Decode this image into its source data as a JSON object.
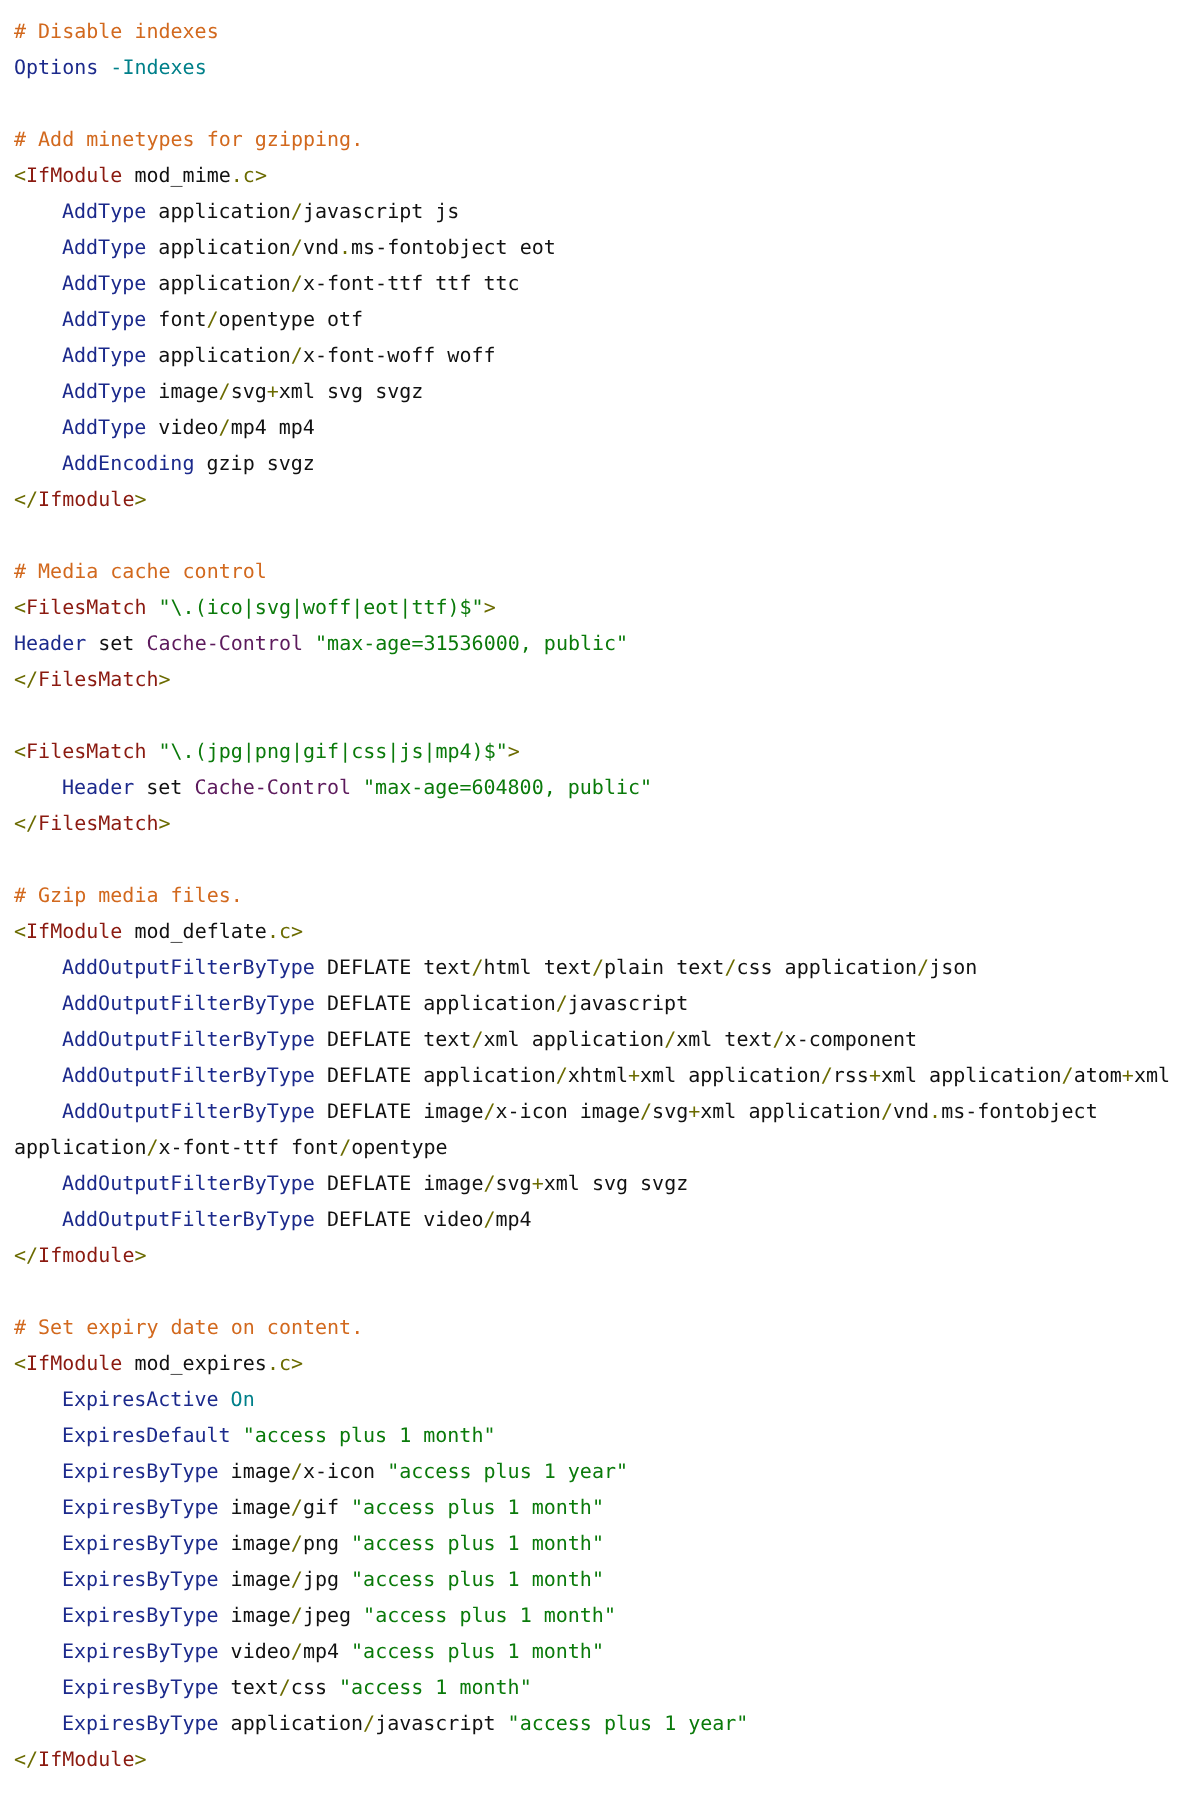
{
  "sections": [
    {
      "lines": [
        {
          "tokens": [
            {
              "kind": "comment",
              "text": "# Disable indexes"
            }
          ]
        },
        {
          "tokens": [
            {
              "kind": "keyword",
              "text": "Options"
            },
            {
              "kind": "constant",
              "text": " -Indexes"
            }
          ]
        }
      ]
    },
    {
      "lines": [
        {
          "tokens": [
            {
              "kind": "comment",
              "text": "# Add minetypes for gzipping."
            }
          ]
        },
        {
          "tokens": [
            {
              "kind": "punct",
              "text": "<"
            },
            {
              "kind": "tag",
              "text": "IfModule"
            },
            {
              "kind": "plain",
              "text": " mod_mime"
            },
            {
              "kind": "punct",
              "text": ".c"
            },
            {
              "kind": "punct",
              "text": ">"
            }
          ],
          "children": [
            {
              "tokens": [
                {
                  "kind": "keyword",
                  "text": "AddType"
                },
                {
                  "kind": "plain",
                  "text": " application"
                },
                {
                  "kind": "punct",
                  "text": "/"
                },
                {
                  "kind": "plain",
                  "text": "javascript js"
                }
              ]
            },
            {
              "tokens": [
                {
                  "kind": "keyword",
                  "text": "AddType"
                },
                {
                  "kind": "plain",
                  "text": " application"
                },
                {
                  "kind": "punct",
                  "text": "/"
                },
                {
                  "kind": "plain",
                  "text": "vnd"
                },
                {
                  "kind": "punct",
                  "text": "."
                },
                {
                  "kind": "plain",
                  "text": "ms-fontobject eot"
                }
              ]
            },
            {
              "tokens": [
                {
                  "kind": "keyword",
                  "text": "AddType"
                },
                {
                  "kind": "plain",
                  "text": " application"
                },
                {
                  "kind": "punct",
                  "text": "/"
                },
                {
                  "kind": "plain",
                  "text": "x-font-ttf ttf ttc"
                }
              ]
            },
            {
              "tokens": [
                {
                  "kind": "keyword",
                  "text": "AddType"
                },
                {
                  "kind": "plain",
                  "text": " font"
                },
                {
                  "kind": "punct",
                  "text": "/"
                },
                {
                  "kind": "plain",
                  "text": "opentype otf"
                }
              ]
            },
            {
              "tokens": [
                {
                  "kind": "keyword",
                  "text": "AddType"
                },
                {
                  "kind": "plain",
                  "text": " application"
                },
                {
                  "kind": "punct",
                  "text": "/"
                },
                {
                  "kind": "plain",
                  "text": "x-font-woff woff"
                }
              ]
            },
            {
              "tokens": [
                {
                  "kind": "keyword",
                  "text": "AddType"
                },
                {
                  "kind": "plain",
                  "text": " image"
                },
                {
                  "kind": "punct",
                  "text": "/"
                },
                {
                  "kind": "plain",
                  "text": "svg"
                },
                {
                  "kind": "punct",
                  "text": "+"
                },
                {
                  "kind": "plain",
                  "text": "xml svg svgz"
                }
              ]
            },
            {
              "tokens": [
                {
                  "kind": "keyword",
                  "text": "AddType"
                },
                {
                  "kind": "plain",
                  "text": " video"
                },
                {
                  "kind": "punct",
                  "text": "/"
                },
                {
                  "kind": "plain",
                  "text": "mp4 mp4"
                }
              ]
            },
            {
              "tokens": [
                {
                  "kind": "keyword",
                  "text": "AddEncoding"
                },
                {
                  "kind": "plain",
                  "text": " gzip svgz"
                }
              ]
            }
          ]
        },
        {
          "tokens": [
            {
              "kind": "punct",
              "text": "</"
            },
            {
              "kind": "tag",
              "text": "Ifmodule"
            },
            {
              "kind": "punct",
              "text": ">"
            }
          ]
        }
      ]
    },
    {
      "lines": [
        {
          "tokens": [
            {
              "kind": "comment",
              "text": "# Media cache control"
            }
          ]
        },
        {
          "tokens": [
            {
              "kind": "punct",
              "text": "<"
            },
            {
              "kind": "tag",
              "text": "FilesMatch"
            },
            {
              "kind": "string",
              "text": " \"\\.(ico|svg|woff|eot|ttf)$\""
            },
            {
              "kind": "punct",
              "text": ">"
            }
          ]
        },
        {
          "tokens": [
            {
              "kind": "keyword",
              "text": "Header"
            },
            {
              "kind": "plain",
              "text": " set "
            },
            {
              "kind": "property",
              "text": "Cache-Control"
            },
            {
              "kind": "string",
              "text": " \"max-age=31536000, public\""
            }
          ]
        },
        {
          "tokens": [
            {
              "kind": "punct",
              "text": "</"
            },
            {
              "kind": "tag",
              "text": "FilesMatch"
            },
            {
              "kind": "punct",
              "text": ">"
            }
          ]
        }
      ]
    },
    {
      "lines": [
        {
          "tokens": [
            {
              "kind": "punct",
              "text": "<"
            },
            {
              "kind": "tag",
              "text": "FilesMatch"
            },
            {
              "kind": "string",
              "text": " \"\\.(jpg|png|gif|css|js|mp4)$\""
            },
            {
              "kind": "punct",
              "text": ">"
            }
          ],
          "children": [
            {
              "tokens": [
                {
                  "kind": "keyword",
                  "text": "Header"
                },
                {
                  "kind": "plain",
                  "text": " set "
                },
                {
                  "kind": "property",
                  "text": "Cache-Control"
                },
                {
                  "kind": "string",
                  "text": " \"max-age=604800, public\""
                }
              ]
            }
          ]
        },
        {
          "tokens": [
            {
              "kind": "punct",
              "text": "</"
            },
            {
              "kind": "tag",
              "text": "FilesMatch"
            },
            {
              "kind": "punct",
              "text": ">"
            }
          ]
        }
      ]
    },
    {
      "lines": [
        {
          "tokens": [
            {
              "kind": "comment",
              "text": "# Gzip media files."
            }
          ]
        },
        {
          "tokens": [
            {
              "kind": "punct",
              "text": "<"
            },
            {
              "kind": "tag",
              "text": "IfModule"
            },
            {
              "kind": "plain",
              "text": " mod_deflate"
            },
            {
              "kind": "punct",
              "text": ".c"
            },
            {
              "kind": "punct",
              "text": ">"
            }
          ],
          "children": [
            {
              "tokens": [
                {
                  "kind": "keyword",
                  "text": "AddOutputFilterByType"
                },
                {
                  "kind": "plain",
                  "text": " DEFLATE text"
                },
                {
                  "kind": "punct",
                  "text": "/"
                },
                {
                  "kind": "plain",
                  "text": "html text"
                },
                {
                  "kind": "punct",
                  "text": "/"
                },
                {
                  "kind": "plain",
                  "text": "plain text"
                },
                {
                  "kind": "punct",
                  "text": "/"
                },
                {
                  "kind": "plain",
                  "text": "css application"
                },
                {
                  "kind": "punct",
                  "text": "/"
                },
                {
                  "kind": "plain",
                  "text": "json"
                }
              ]
            },
            {
              "tokens": [
                {
                  "kind": "keyword",
                  "text": "AddOutputFilterByType"
                },
                {
                  "kind": "plain",
                  "text": " DEFLATE application"
                },
                {
                  "kind": "punct",
                  "text": "/"
                },
                {
                  "kind": "plain",
                  "text": "javascript"
                }
              ]
            },
            {
              "tokens": [
                {
                  "kind": "keyword",
                  "text": "AddOutputFilterByType"
                },
                {
                  "kind": "plain",
                  "text": " DEFLATE text"
                },
                {
                  "kind": "punct",
                  "text": "/"
                },
                {
                  "kind": "plain",
                  "text": "xml application"
                },
                {
                  "kind": "punct",
                  "text": "/"
                },
                {
                  "kind": "plain",
                  "text": "xml text"
                },
                {
                  "kind": "punct",
                  "text": "/"
                },
                {
                  "kind": "plain",
                  "text": "x-component"
                }
              ]
            },
            {
              "tokens": [
                {
                  "kind": "keyword",
                  "text": "AddOutputFilterByType"
                },
                {
                  "kind": "plain",
                  "text": " DEFLATE application"
                },
                {
                  "kind": "punct",
                  "text": "/"
                },
                {
                  "kind": "plain",
                  "text": "xhtml"
                },
                {
                  "kind": "punct",
                  "text": "+"
                },
                {
                  "kind": "plain",
                  "text": "xml application"
                },
                {
                  "kind": "punct",
                  "text": "/"
                },
                {
                  "kind": "plain",
                  "text": "rss"
                },
                {
                  "kind": "punct",
                  "text": "+"
                },
                {
                  "kind": "plain",
                  "text": "xml application"
                },
                {
                  "kind": "punct",
                  "text": "/"
                },
                {
                  "kind": "plain",
                  "text": "atom"
                },
                {
                  "kind": "punct",
                  "text": "+"
                },
                {
                  "kind": "plain",
                  "text": "xml"
                }
              ]
            },
            {
              "tokens": [
                {
                  "kind": "keyword",
                  "text": "AddOutputFilterByType"
                },
                {
                  "kind": "plain",
                  "text": " DEFLATE image"
                },
                {
                  "kind": "punct",
                  "text": "/"
                },
                {
                  "kind": "plain",
                  "text": "x-icon image"
                },
                {
                  "kind": "punct",
                  "text": "/"
                },
                {
                  "kind": "plain",
                  "text": "svg"
                },
                {
                  "kind": "punct",
                  "text": "+"
                },
                {
                  "kind": "plain",
                  "text": "xml application"
                },
                {
                  "kind": "punct",
                  "text": "/"
                },
                {
                  "kind": "plain",
                  "text": "vnd"
                },
                {
                  "kind": "punct",
                  "text": "."
                },
                {
                  "kind": "plain",
                  "text": "ms-fontobject application"
                },
                {
                  "kind": "punct",
                  "text": "/"
                },
                {
                  "kind": "plain",
                  "text": "x-font-ttf font"
                },
                {
                  "kind": "punct",
                  "text": "/"
                },
                {
                  "kind": "plain",
                  "text": "opentype"
                }
              ]
            },
            {
              "tokens": [
                {
                  "kind": "keyword",
                  "text": "AddOutputFilterByType"
                },
                {
                  "kind": "plain",
                  "text": " DEFLATE image"
                },
                {
                  "kind": "punct",
                  "text": "/"
                },
                {
                  "kind": "plain",
                  "text": "svg"
                },
                {
                  "kind": "punct",
                  "text": "+"
                },
                {
                  "kind": "plain",
                  "text": "xml svg svgz"
                }
              ]
            },
            {
              "tokens": [
                {
                  "kind": "keyword",
                  "text": "AddOutputFilterByType"
                },
                {
                  "kind": "plain",
                  "text": " DEFLATE video"
                },
                {
                  "kind": "punct",
                  "text": "/"
                },
                {
                  "kind": "plain",
                  "text": "mp4"
                }
              ]
            }
          ]
        },
        {
          "tokens": [
            {
              "kind": "punct",
              "text": "</"
            },
            {
              "kind": "tag",
              "text": "Ifmodule"
            },
            {
              "kind": "punct",
              "text": ">"
            }
          ]
        }
      ]
    },
    {
      "lines": [
        {
          "tokens": [
            {
              "kind": "comment",
              "text": "# Set expiry date on content."
            }
          ]
        },
        {
          "tokens": [
            {
              "kind": "punct",
              "text": "<"
            },
            {
              "kind": "tag",
              "text": "IfModule"
            },
            {
              "kind": "plain",
              "text": " mod_expires"
            },
            {
              "kind": "punct",
              "text": ".c"
            },
            {
              "kind": "punct",
              "text": ">"
            }
          ],
          "children": [
            {
              "tokens": [
                {
                  "kind": "keyword",
                  "text": "ExpiresActive"
                },
                {
                  "kind": "constant",
                  "text": " On"
                }
              ]
            },
            {
              "tokens": [
                {
                  "kind": "keyword",
                  "text": "ExpiresDefault"
                },
                {
                  "kind": "string",
                  "text": " \"access plus 1 month\""
                }
              ]
            },
            {
              "tokens": [
                {
                  "kind": "keyword",
                  "text": "ExpiresByType"
                },
                {
                  "kind": "plain",
                  "text": " image"
                },
                {
                  "kind": "punct",
                  "text": "/"
                },
                {
                  "kind": "plain",
                  "text": "x-icon "
                },
                {
                  "kind": "string",
                  "text": "\"access plus 1 year\""
                }
              ]
            },
            {
              "tokens": [
                {
                  "kind": "keyword",
                  "text": "ExpiresByType"
                },
                {
                  "kind": "plain",
                  "text": " image"
                },
                {
                  "kind": "punct",
                  "text": "/"
                },
                {
                  "kind": "plain",
                  "text": "gif "
                },
                {
                  "kind": "string",
                  "text": "\"access plus 1 month\""
                }
              ]
            },
            {
              "tokens": [
                {
                  "kind": "keyword",
                  "text": "ExpiresByType"
                },
                {
                  "kind": "plain",
                  "text": " image"
                },
                {
                  "kind": "punct",
                  "text": "/"
                },
                {
                  "kind": "plain",
                  "text": "png "
                },
                {
                  "kind": "string",
                  "text": "\"access plus 1 month\""
                }
              ]
            },
            {
              "tokens": [
                {
                  "kind": "keyword",
                  "text": "ExpiresByType"
                },
                {
                  "kind": "plain",
                  "text": " image"
                },
                {
                  "kind": "punct",
                  "text": "/"
                },
                {
                  "kind": "plain",
                  "text": "jpg "
                },
                {
                  "kind": "string",
                  "text": "\"access plus 1 month\""
                }
              ]
            },
            {
              "tokens": [
                {
                  "kind": "keyword",
                  "text": "ExpiresByType"
                },
                {
                  "kind": "plain",
                  "text": " image"
                },
                {
                  "kind": "punct",
                  "text": "/"
                },
                {
                  "kind": "plain",
                  "text": "jpeg "
                },
                {
                  "kind": "string",
                  "text": "\"access plus 1 month\""
                }
              ]
            },
            {
              "tokens": [
                {
                  "kind": "keyword",
                  "text": "ExpiresByType"
                },
                {
                  "kind": "plain",
                  "text": " video"
                },
                {
                  "kind": "punct",
                  "text": "/"
                },
                {
                  "kind": "plain",
                  "text": "mp4 "
                },
                {
                  "kind": "string",
                  "text": "\"access plus 1 month\""
                }
              ]
            },
            {
              "tokens": [
                {
                  "kind": "keyword",
                  "text": "ExpiresByType"
                },
                {
                  "kind": "plain",
                  "text": " text"
                },
                {
                  "kind": "punct",
                  "text": "/"
                },
                {
                  "kind": "plain",
                  "text": "css "
                },
                {
                  "kind": "string",
                  "text": "\"access 1 month\""
                }
              ]
            },
            {
              "tokens": [
                {
                  "kind": "keyword",
                  "text": "ExpiresByType"
                },
                {
                  "kind": "plain",
                  "text": " application"
                },
                {
                  "kind": "punct",
                  "text": "/"
                },
                {
                  "kind": "plain",
                  "text": "javascript "
                },
                {
                  "kind": "string",
                  "text": "\"access plus 1 year\""
                }
              ]
            }
          ]
        },
        {
          "tokens": [
            {
              "kind": "punct",
              "text": "</"
            },
            {
              "kind": "tag",
              "text": "IfModule"
            },
            {
              "kind": "punct",
              "text": ">"
            }
          ]
        }
      ]
    }
  ]
}
